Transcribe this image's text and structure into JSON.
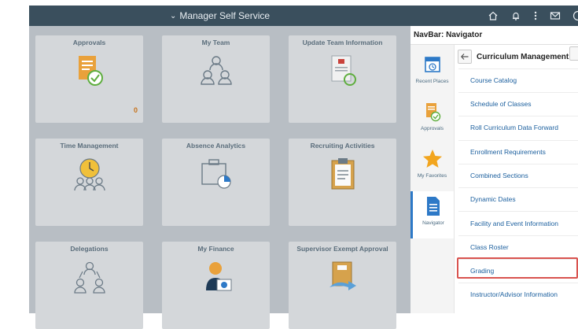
{
  "topbar": {
    "title": "Manager Self Service",
    "icons": [
      "home-icon",
      "bell-icon",
      "kebab-icon",
      "mail-icon",
      "compass-icon"
    ]
  },
  "tiles": [
    {
      "title": "Approvals",
      "icon": "approvals-icon",
      "count": "0"
    },
    {
      "title": "My Team",
      "icon": "team-icon"
    },
    {
      "title": "Update Team Information",
      "icon": "update-info-icon"
    },
    {
      "title": "Time Management",
      "icon": "time-management-icon"
    },
    {
      "title": "Absence Analytics",
      "icon": "absence-analytics-icon"
    },
    {
      "title": "Recruiting Activities",
      "icon": "clipboard-icon"
    },
    {
      "title": "Delegations",
      "icon": "delegations-icon"
    },
    {
      "title": "My Finance",
      "icon": "finance-icon"
    },
    {
      "title": "Supervisor Exempt Approval",
      "icon": "exempt-approval-icon"
    }
  ],
  "navbar": {
    "title": "NavBar: Navigator",
    "rail": [
      {
        "label": "Recent Places",
        "icon": "calendar-clock-icon"
      },
      {
        "label": "Approvals",
        "icon": "approvals-icon"
      },
      {
        "label": "My Favorites",
        "icon": "star-icon"
      },
      {
        "label": "Navigator",
        "icon": "document-icon",
        "active": true
      }
    ],
    "section": "Curriculum Management",
    "items": [
      "Course Catalog",
      "Schedule of Classes",
      "Roll Curriculum Data Forward",
      "Enrollment Requirements",
      "Combined Sections",
      "Dynamic Dates",
      "Facility and Event Information",
      "Class Roster",
      "Grading",
      "Instructor/Advisor Information"
    ],
    "highlighted": "Grading"
  },
  "colors": {
    "topbar": "#3a4f5d",
    "tile_title": "#5b6e7c",
    "link": "#1b5f9e",
    "highlight": "#d9534f",
    "accent": "#2d79c7"
  }
}
